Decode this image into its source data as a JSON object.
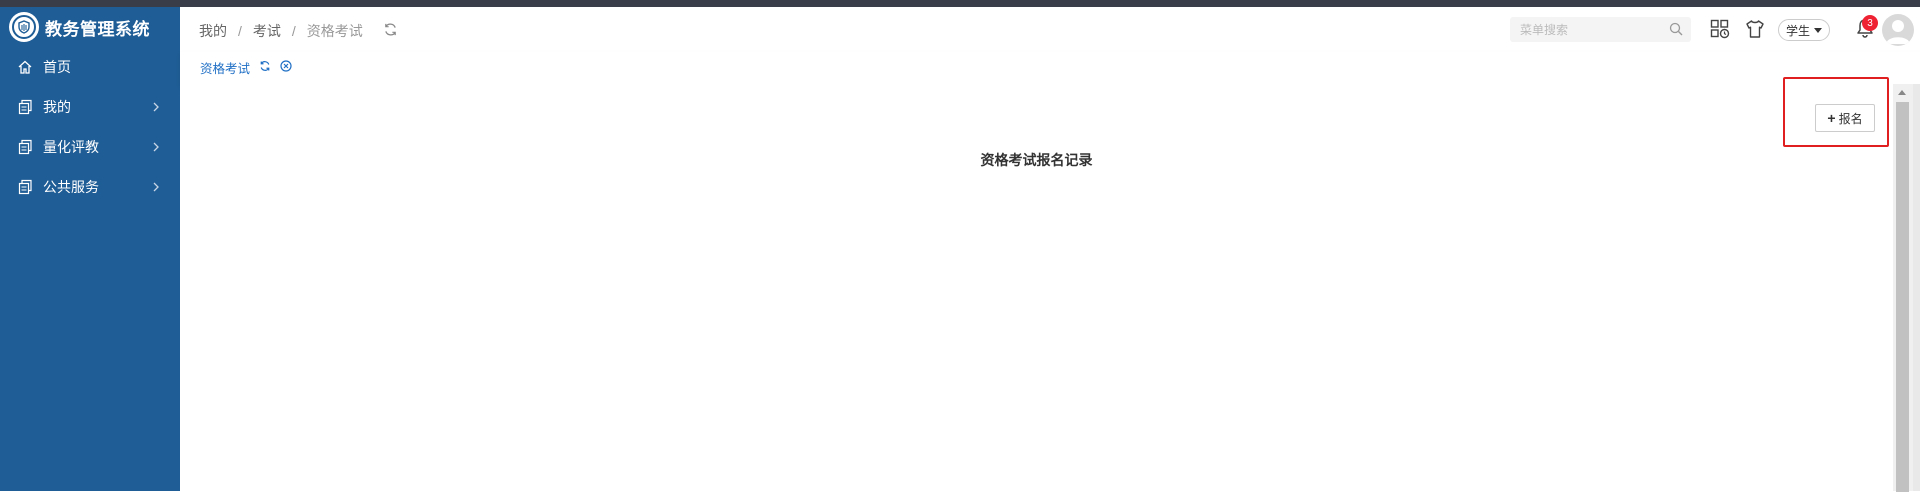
{
  "app": {
    "title": "教务管理系统"
  },
  "sidebar": {
    "items": [
      {
        "label": "首页",
        "icon": "home-icon",
        "has_children": false
      },
      {
        "label": "我的",
        "icon": "document-icon",
        "has_children": true
      },
      {
        "label": "量化评教",
        "icon": "document-icon",
        "has_children": true
      },
      {
        "label": "公共服务",
        "icon": "document-icon",
        "has_children": true
      }
    ]
  },
  "header": {
    "breadcrumb": [
      "我的",
      "考试",
      "资格考试"
    ],
    "search": {
      "placeholder": "菜单搜索"
    },
    "role": "学生",
    "notifications": {
      "count": "3"
    }
  },
  "tabs": [
    {
      "label": "资格考试",
      "active": true
    }
  ],
  "main": {
    "heading": "资格考试报名记录",
    "signup_button": "报名"
  },
  "colors": {
    "sidebar_bg": "#1f5d96",
    "accent": "#1f6fc5",
    "badge": "#e22233",
    "highlight": "#e02020"
  }
}
